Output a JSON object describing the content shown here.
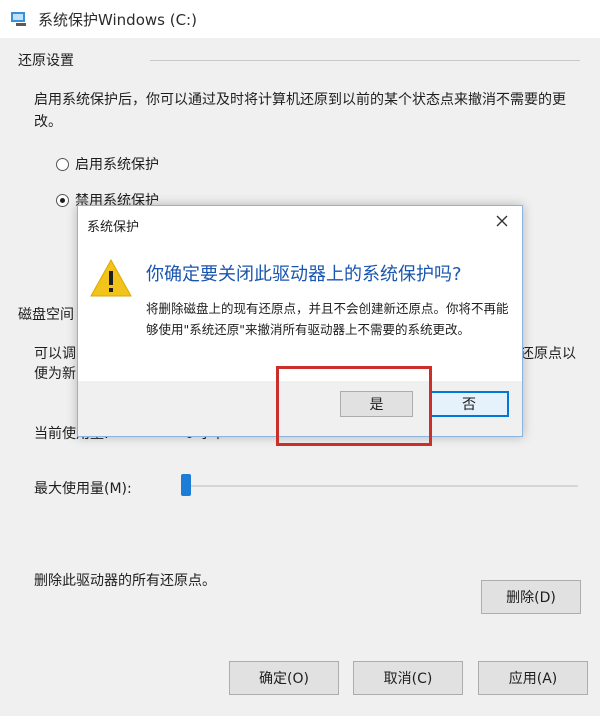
{
  "window": {
    "title": "系统保护Windows (C:)"
  },
  "restore": {
    "group_title": "还原设置",
    "description": "启用系统保护后，你可以通过及时将计算机还原到以前的某个状态点来撤消不需要的更改。",
    "option_enable": "启用系统保护",
    "option_disable": "禁用系统保护",
    "selected": "禁用系统保护"
  },
  "disk": {
    "group_title": "磁盘空间",
    "text_line1": "可以调",
    "text_line2": "便为新",
    "text_right1": "还原点以",
    "current_usage_label": "当前使用量:",
    "current_usage_value": "0 字节",
    "max_usage_label": "最大使用量(M):",
    "slider_fraction": 0.0
  },
  "delete": {
    "label": "删除此驱动器的所有还原点。",
    "button": "删除(D)"
  },
  "footer": {
    "ok": "确定(O)",
    "cancel": "取消(C)",
    "apply": "应用(A)"
  },
  "dialog": {
    "title": "系统保护",
    "question": "你确定要关闭此驱动器上的系统保护吗?",
    "message": "将删除磁盘上的现有还原点，并且不会创建新还原点。你将不再能够使用\"系统还原\"来撤消所有驱动器上不需要的系统更改。",
    "yes": "是",
    "no": "否"
  },
  "colors": {
    "accent": "#0078d7",
    "question_text": "#1a56b0",
    "highlight": "#c9302c",
    "warning": "#f2c31a"
  }
}
